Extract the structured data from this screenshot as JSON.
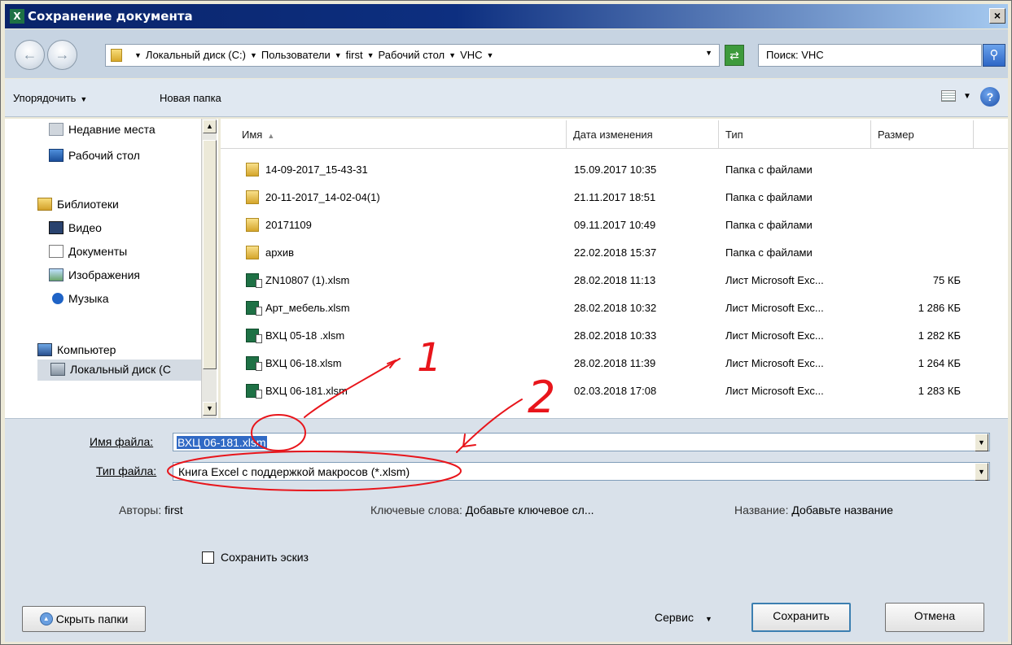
{
  "window": {
    "title": "Сохранение документа",
    "app_icon": "excel-icon",
    "close_glyph": "×"
  },
  "address": {
    "crumbs": [
      "Локальный диск (C:)",
      "Пользователи",
      "first",
      "Рабочий стол",
      "VHC"
    ],
    "search_placeholder": "Поиск: VHC"
  },
  "toolbar": {
    "organize": "Упорядочить",
    "new_folder": "Новая папка",
    "help_glyph": "?"
  },
  "nav": {
    "recent": "Недавние места",
    "desktop": "Рабочий стол",
    "libraries": "Библиотеки",
    "video": "Видео",
    "documents": "Документы",
    "images": "Изображения",
    "music": "Музыка",
    "computer": "Компьютер",
    "local_disk": "Локальный диск (С"
  },
  "columns": {
    "name": "Имя",
    "date": "Дата изменения",
    "type": "Тип",
    "size": "Размер"
  },
  "files": [
    {
      "name": "14-09-2017_15-43-31",
      "date": "15.09.2017 10:35",
      "type": "Папка с файлами",
      "size": "",
      "icon": "folder"
    },
    {
      "name": "20-11-2017_14-02-04(1)",
      "date": "21.11.2017 18:51",
      "type": "Папка с файлами",
      "size": "",
      "icon": "folder"
    },
    {
      "name": "20171109",
      "date": "09.11.2017 10:49",
      "type": "Папка с файлами",
      "size": "",
      "icon": "folder"
    },
    {
      "name": "архив",
      "date": "22.02.2018 15:37",
      "type": "Папка с файлами",
      "size": "",
      "icon": "folder"
    },
    {
      "name": "ZN10807 (1).xlsm",
      "date": "28.02.2018 11:13",
      "type": "Лист Microsoft Exc...",
      "size": "75 КБ",
      "icon": "excel"
    },
    {
      "name": "Арт_мебель.xlsm",
      "date": "28.02.2018 10:32",
      "type": "Лист Microsoft Exc...",
      "size": "1 286 КБ",
      "icon": "excel"
    },
    {
      "name": "ВХЦ 05-18 .xlsm",
      "date": "28.02.2018 10:33",
      "type": "Лист Microsoft Exc...",
      "size": "1 282 КБ",
      "icon": "excel"
    },
    {
      "name": "ВХЦ 06-18.xlsm",
      "date": "28.02.2018 11:39",
      "type": "Лист Microsoft Exc...",
      "size": "1 264 КБ",
      "icon": "excel"
    },
    {
      "name": "ВХЦ 06-181.xlsm",
      "date": "02.03.2018 17:08",
      "type": "Лист Microsoft Exc...",
      "size": "1 283 КБ",
      "icon": "excel"
    }
  ],
  "form": {
    "filename_label": "Имя файла:",
    "filename_value": "ВХЦ 06-181.xlsm",
    "filetype_label": "Тип файла:",
    "filetype_value": "Книга Excel с поддержкой макросов (*.xlsm)",
    "authors_label": "Авторы:",
    "authors_value": "first",
    "keywords_label": "Ключевые слова:",
    "keywords_value": "Добавьте ключевое сл...",
    "title_label": "Название:",
    "title_value": "Добавьте название",
    "thumbnail_label": "Сохранить эскиз"
  },
  "buttons": {
    "hide_folders": "Скрыть папки",
    "tools": "Сервис",
    "save": "Сохранить",
    "cancel": "Отмена"
  },
  "annotations": {
    "mark1": "1",
    "mark2": "2",
    "color": "#e8151b"
  },
  "colors": {
    "titlebar": "#0a246a",
    "selection": "#316ac5",
    "address_bg": "#c7d4e2"
  }
}
